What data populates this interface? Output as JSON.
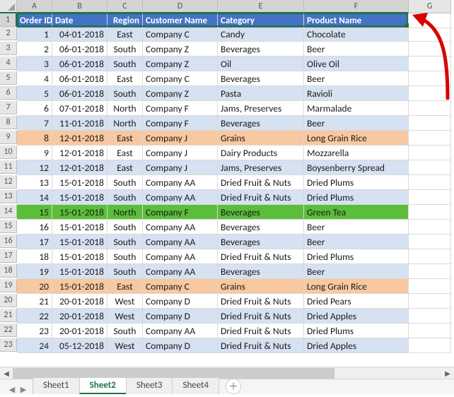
{
  "columns": [
    "A",
    "B",
    "C",
    "D",
    "E",
    "F",
    "G"
  ],
  "headers": {
    "A": "Order ID",
    "B": "Date",
    "C": "Region",
    "D": "Customer Name",
    "E": "Category",
    "F": "Product Name"
  },
  "rows": [
    {
      "n": "2",
      "band": "blue",
      "id": "1",
      "date": "04-01-2018",
      "region": "East",
      "cust": "Company C",
      "cat": "Candy",
      "prod": "Chocolate"
    },
    {
      "n": "3",
      "band": "white",
      "id": "2",
      "date": "06-01-2018",
      "region": "South",
      "cust": "Company Z",
      "cat": "Beverages",
      "prod": "Beer"
    },
    {
      "n": "4",
      "band": "blue",
      "id": "3",
      "date": "06-01-2018",
      "region": "South",
      "cust": "Company Z",
      "cat": "Oil",
      "prod": "Olive Oil"
    },
    {
      "n": "5",
      "band": "white",
      "id": "4",
      "date": "06-01-2018",
      "region": "East",
      "cust": "Company C",
      "cat": "Beverages",
      "prod": "Beer"
    },
    {
      "n": "6",
      "band": "blue",
      "id": "5",
      "date": "06-01-2018",
      "region": "South",
      "cust": "Company Z",
      "cat": "Pasta",
      "prod": "Ravioli"
    },
    {
      "n": "7",
      "band": "white",
      "id": "6",
      "date": "07-01-2018",
      "region": "North",
      "cust": "Company F",
      "cat": "Jams, Preserves",
      "prod": "Marmalade"
    },
    {
      "n": "8",
      "band": "blue",
      "id": "7",
      "date": "11-01-2018",
      "region": "North",
      "cust": "Company F",
      "cat": "Beverages",
      "prod": "Beer"
    },
    {
      "n": "9",
      "band": "orange",
      "id": "8",
      "date": "12-01-2018",
      "region": "East",
      "cust": "Company J",
      "cat": "Grains",
      "prod": "Long Grain Rice"
    },
    {
      "n": "10",
      "band": "white",
      "id": "9",
      "date": "12-01-2018",
      "region": "East",
      "cust": "Company J",
      "cat": "Dairy Products",
      "prod": "Mozzarella"
    },
    {
      "n": "11",
      "band": "blue",
      "id": "12",
      "date": "12-01-2018",
      "region": "East",
      "cust": "Company J",
      "cat": "Jams, Preserves",
      "prod": "Boysenberry Spread"
    },
    {
      "n": "12",
      "band": "white",
      "id": "13",
      "date": "15-01-2018",
      "region": "South",
      "cust": "Company AA",
      "cat": "Dried Fruit & Nuts",
      "prod": "Dried Plums"
    },
    {
      "n": "13",
      "band": "blue",
      "id": "14",
      "date": "15-01-2018",
      "region": "South",
      "cust": "Company AA",
      "cat": "Dried Fruit & Nuts",
      "prod": "Dried Plums"
    },
    {
      "n": "14",
      "band": "green",
      "id": "15",
      "date": "15-01-2018",
      "region": "North",
      "cust": "Company F",
      "cat": "Beverages",
      "prod": "Green Tea"
    },
    {
      "n": "15",
      "band": "white",
      "id": "16",
      "date": "15-01-2018",
      "region": "South",
      "cust": "Company AA",
      "cat": "Beverages",
      "prod": "Beer"
    },
    {
      "n": "16",
      "band": "blue",
      "id": "17",
      "date": "15-01-2018",
      "region": "South",
      "cust": "Company AA",
      "cat": "Beverages",
      "prod": "Beer"
    },
    {
      "n": "17",
      "band": "white",
      "id": "18",
      "date": "15-01-2018",
      "region": "South",
      "cust": "Company AA",
      "cat": "Dried Fruit & Nuts",
      "prod": "Dried Plums"
    },
    {
      "n": "18",
      "band": "blue",
      "id": "19",
      "date": "15-01-2018",
      "region": "South",
      "cust": "Company AA",
      "cat": "Beverages",
      "prod": "Beer"
    },
    {
      "n": "19",
      "band": "orange",
      "id": "20",
      "date": "15-01-2018",
      "region": "East",
      "cust": "Company C",
      "cat": "Grains",
      "prod": "Long Grain Rice"
    },
    {
      "n": "20",
      "band": "white",
      "id": "21",
      "date": "20-01-2018",
      "region": "West",
      "cust": "Company D",
      "cat": "Dried Fruit & Nuts",
      "prod": "Dried Pears"
    },
    {
      "n": "21",
      "band": "blue",
      "id": "22",
      "date": "20-01-2018",
      "region": "West",
      "cust": "Company D",
      "cat": "Dried Fruit & Nuts",
      "prod": "Dried Apples"
    },
    {
      "n": "22",
      "band": "white",
      "id": "23",
      "date": "20-01-2018",
      "region": "South",
      "cust": "Company AA",
      "cat": "Dried Fruit & Nuts",
      "prod": "Dried Plums"
    },
    {
      "n": "23",
      "band": "blue",
      "id": "24",
      "date": "05-12-2018",
      "region": "West",
      "cust": "Company D",
      "cat": "Dried Fruit & Nuts",
      "prod": "Dried Apples"
    }
  ],
  "tabs": [
    "Sheet1",
    "Sheet2",
    "Sheet3",
    "Sheet4"
  ],
  "activeTab": "Sheet2",
  "selectedRow": "1"
}
